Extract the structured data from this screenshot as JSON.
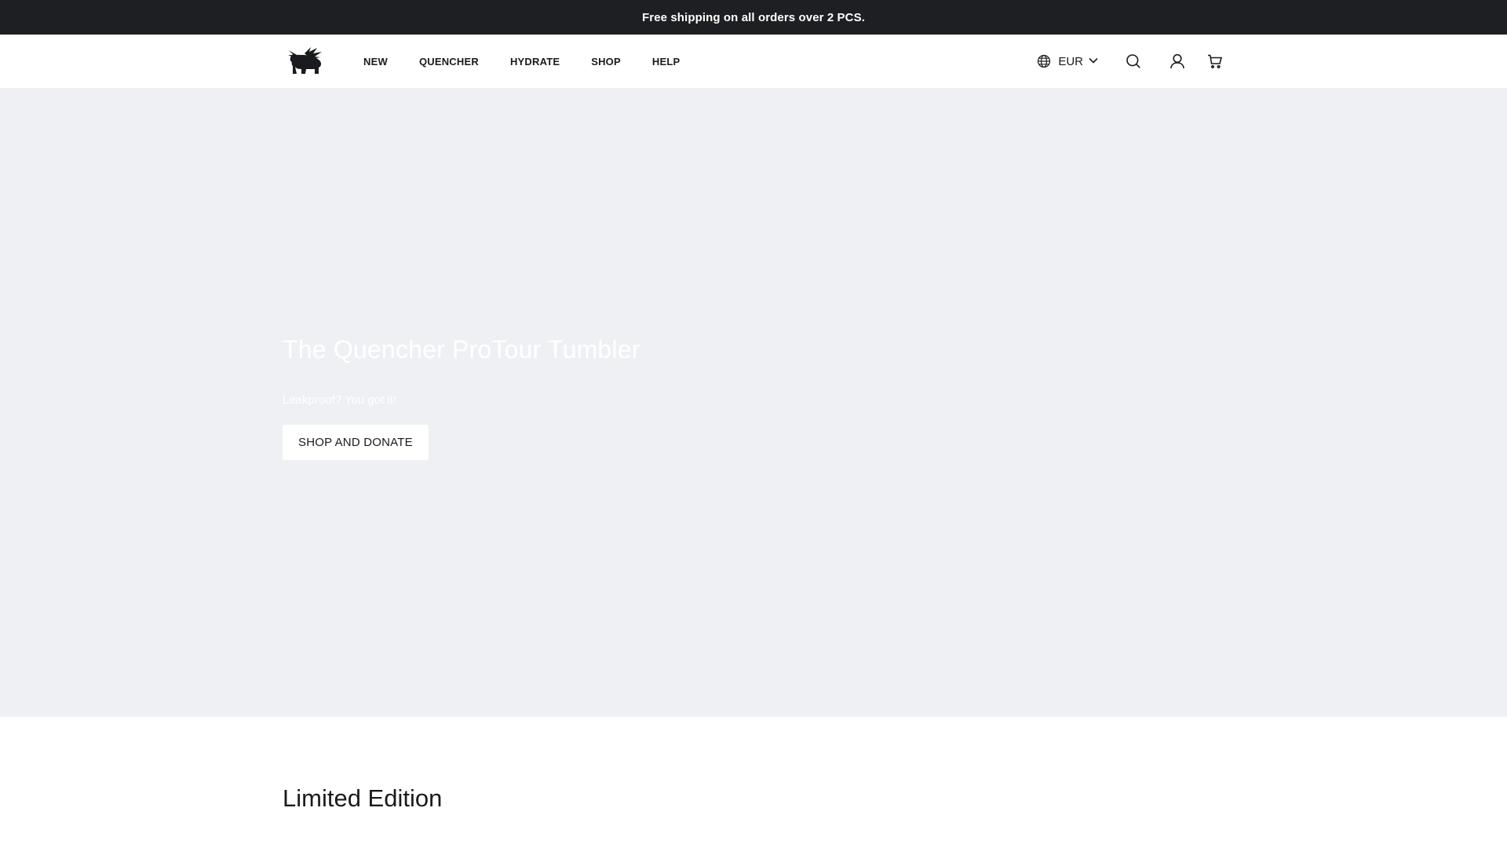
{
  "announcement": {
    "text": "Free shipping on all orders over 2 PCS."
  },
  "header": {
    "logo_icon": "winged-bear-logo-icon",
    "nav": [
      {
        "label": "NEW"
      },
      {
        "label": "QUENCHER"
      },
      {
        "label": "HYDRATE"
      },
      {
        "label": "SHOP"
      },
      {
        "label": "HELP"
      }
    ],
    "currency": {
      "label": "EUR",
      "icon": "globe-icon",
      "chevron": "chevron-down-icon"
    },
    "icons": {
      "search": "search-icon",
      "account": "user-icon",
      "cart": "cart-icon"
    }
  },
  "hero": {
    "title": "The Quencher ProTour Tumbler",
    "subtitle": "Leakproof? You got it!",
    "cta_label": "SHOP AND DONATE",
    "background_color": "#eff0f4"
  },
  "section": {
    "title": "Limited Edition"
  },
  "colors": {
    "announcement_bg": "#1e1f23",
    "text": "#1a1b1f",
    "white": "#ffffff"
  }
}
